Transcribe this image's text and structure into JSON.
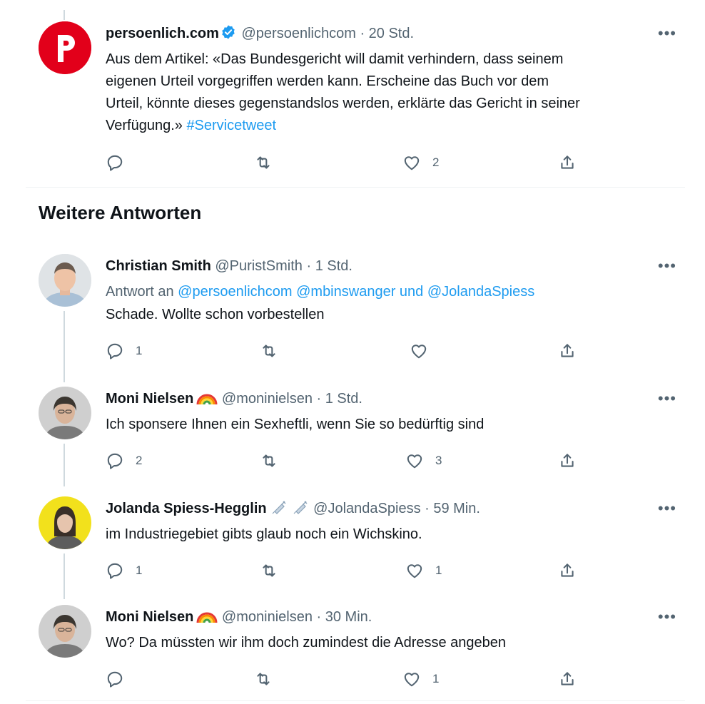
{
  "section_title": "Weitere Antworten",
  "colors": {
    "link": "#1d9bf0",
    "meta": "#536471",
    "verified": "#1d9bf0",
    "logo_red": "#e2001a"
  },
  "tweets": [
    {
      "avatar": "persoenlich-logo",
      "name": "persoenlich.com",
      "verified": true,
      "handle": "@persoenlichcom",
      "time": "· 20 Std.",
      "text_lines": [
        "Aus dem Artikel: «Das Bundesgericht will damit verhindern, dass seinem",
        "eigenen Urteil vorgegriffen werden kann. Erscheine das Buch vor dem",
        "Urteil, könnte dieses gegenstandslos werden, erklärte das Gericht in seiner"
      ],
      "text_last": "Verfügung.»",
      "hashtag": "#Servicetweet",
      "reply_count": "",
      "retweet_count": "",
      "like_count": "2"
    },
    {
      "avatar": "christian-smith",
      "name": "Christian Smith",
      "handle": "@PuristSmith",
      "time": "· 1 Std.",
      "reply_prefix": "Antwort an",
      "reply_to": "@persoenlichcom @mbinswanger und @JolandaSpiess",
      "text": "Schade. Wollte schon vorbestellen",
      "reply_count": "1",
      "retweet_count": "",
      "like_count": ""
    },
    {
      "avatar": "moni-nielsen",
      "name": "Moni Nielsen",
      "emoji": "rainbow",
      "handle": "@moninielsen",
      "time": "· 1 Std.",
      "text": "Ich sponsere Ihnen ein Sexheftli, wenn Sie so bedürftig sind",
      "reply_count": "2",
      "retweet_count": "",
      "like_count": "3"
    },
    {
      "avatar": "jolanda-spiess",
      "name": "Jolanda Spiess-Hegglin",
      "emoji": "syringe syringe",
      "handle": "@JolandaSpiess",
      "time": "· 59 Min.",
      "text": "im Industriegebiet gibts glaub noch ein Wichskino.",
      "reply_count": "1",
      "retweet_count": "",
      "like_count": "1"
    },
    {
      "avatar": "moni-nielsen",
      "name": "Moni Nielsen",
      "emoji": "rainbow",
      "handle": "@moninielsen",
      "time": "· 30 Min.",
      "text": "Wo? Da müssten wir ihm doch zumindest die Adresse angeben",
      "reply_count": "",
      "retweet_count": "",
      "like_count": "1"
    }
  ],
  "more_label": "•••"
}
